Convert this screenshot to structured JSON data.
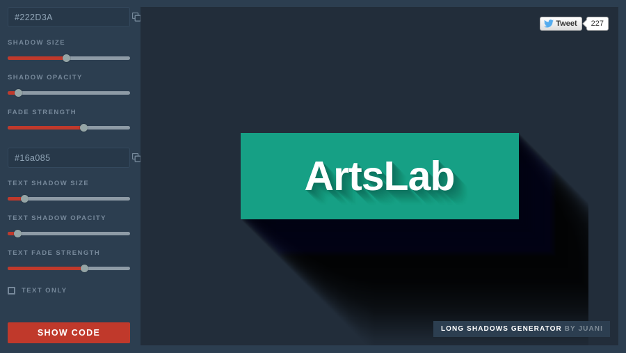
{
  "app": {
    "name": "Long Shadows Generator",
    "colors": {
      "sidebar_bg": "#2c3e50",
      "preview_bg": "#222D3A",
      "accent_red": "#c0392b",
      "shape_teal": "#16a085",
      "label_text": "#76889a"
    }
  },
  "sidebar": {
    "shape_color_field": {
      "value": "#222D3A",
      "placeholder": "#222D3A",
      "copy_icon": "copy-icon"
    },
    "text_color_field": {
      "value": "#16a085",
      "placeholder": "#16a085",
      "copy_icon": "copy-icon"
    },
    "sliders": [
      {
        "label": "SHADOW SIZE",
        "percent": 48
      },
      {
        "label": "SHADOW OPACITY",
        "percent": 9
      },
      {
        "label": "FADE STRENGTH",
        "percent": 62
      },
      {
        "label": "TEXT SHADOW SIZE",
        "percent": 14
      },
      {
        "label": "TEXT SHADOW OPACITY",
        "percent": 8
      },
      {
        "label": "TEXT FADE STRENGTH",
        "percent": 63
      }
    ],
    "text_only": {
      "label": "TEXT ONLY",
      "checked": false
    },
    "show_code_label": "SHOW CODE"
  },
  "preview": {
    "box_text": "ArtsLab",
    "box_color": "#16a085",
    "background_color": "#222D3A"
  },
  "share": {
    "tweet_label": "Tweet",
    "tweet_count": "227",
    "bird_icon": "twitter-bird-icon"
  },
  "credit": {
    "title": "LONG SHADOWS GENERATOR",
    "by": "BY JUANI"
  }
}
